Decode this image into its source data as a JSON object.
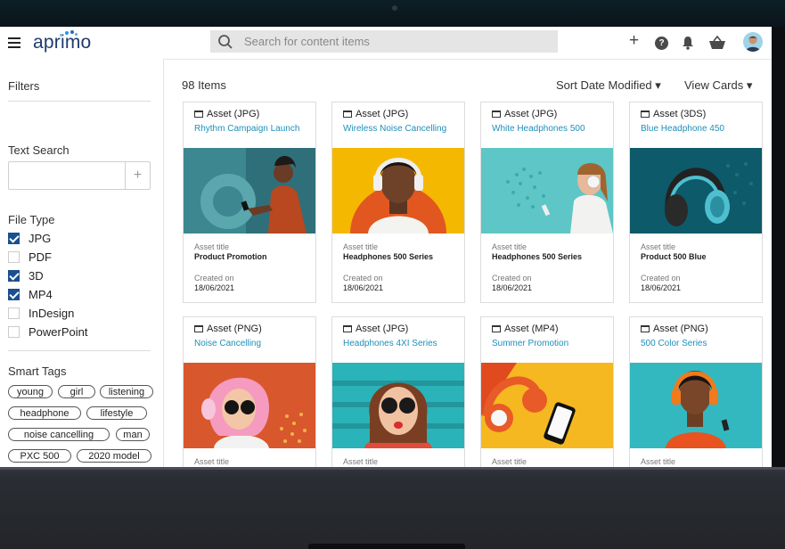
{
  "header": {
    "brand": "aprimo",
    "search_placeholder": "Search for content items",
    "help_glyph": "?",
    "plus_glyph": "+"
  },
  "sidebar": {
    "filters_label": "Filters",
    "text_search_label": "Text Search",
    "text_search_value": "",
    "file_type_label": "File Type",
    "file_types": [
      {
        "label": "JPG",
        "checked": true
      },
      {
        "label": "PDF",
        "checked": false
      },
      {
        "label": "3D",
        "checked": true
      },
      {
        "label": "MP4",
        "checked": true
      },
      {
        "label": "InDesign",
        "checked": false
      },
      {
        "label": "PowerPoint",
        "checked": false
      }
    ],
    "smart_tags_label": "Smart Tags",
    "smart_tags": [
      "young",
      "girl",
      "listening",
      "headphone",
      "lifestyle",
      "noise cancelling",
      "man",
      "PXC 500",
      "2020 model"
    ]
  },
  "main": {
    "items_count": "98 Items",
    "sort_label": "Sort Date Modified ▾",
    "view_label": "View Cards ▾",
    "cards": [
      {
        "type": "Asset (JPG)",
        "title": "Rhythm Campaign Launch",
        "asset_title_label": "Asset title",
        "asset_title": "Product Promotion",
        "created_label": "Created on",
        "created": "18/06/2021",
        "image": "woman-phone-teal-icon"
      },
      {
        "type": "Asset (JPG)",
        "title": "Wireless Noise Cancelling",
        "asset_title_label": "Asset title",
        "asset_title": "Headphones 500 Series",
        "created_label": "Created on",
        "created": "18/06/2021",
        "image": "man-headphones-orange-icon"
      },
      {
        "type": "Asset (JPG)",
        "title": "White Headphones 500",
        "asset_title_label": "Asset title",
        "asset_title": "Headphones 500 Series",
        "created_label": "Created on",
        "created": "18/06/2021",
        "image": "woman-headphones-mint-icon"
      },
      {
        "type": "Asset (3DS)",
        "title": "Blue Headphone 450",
        "asset_title_label": "Asset title",
        "asset_title": "Product 500 Blue",
        "created_label": "Created on",
        "created": "18/06/2021",
        "image": "blue-headphone-icon"
      },
      {
        "type": "Asset (PNG)",
        "title": "Noise Cancelling",
        "asset_title_label": "Asset title",
        "image": "pink-hair-woman-icon"
      },
      {
        "type": "Asset (JPG)",
        "title": "Headphones 4XI Series",
        "asset_title_label": "Asset title",
        "image": "woman-sunglasses-teal-icon"
      },
      {
        "type": "Asset (MP4)",
        "title": "Summer Promotion",
        "asset_title_label": "Asset title",
        "image": "headphones-phone-yellow-icon"
      },
      {
        "type": "Asset (PNG)",
        "title": "500 Color Series",
        "asset_title_label": "Asset title",
        "image": "man-orange-headphones-icon"
      }
    ]
  },
  "colors": {
    "accent": "#1e8fb8",
    "checkbox": "#1b4f8f",
    "brand": "#1f3a6e"
  }
}
